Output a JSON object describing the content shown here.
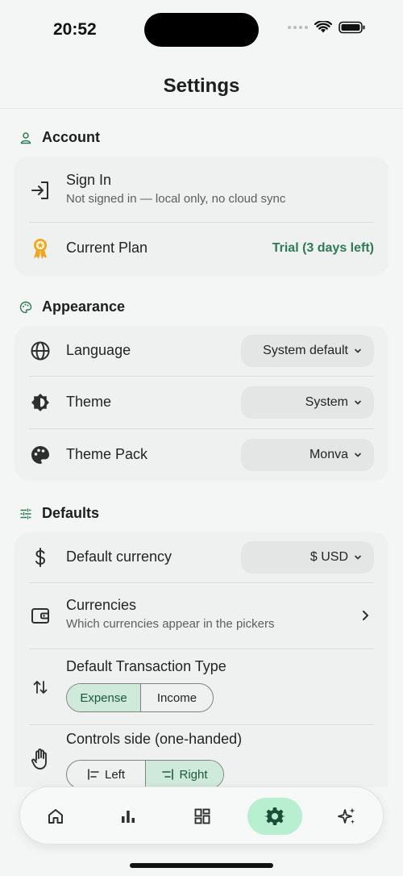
{
  "status": {
    "time": "20:52"
  },
  "header": {
    "title": "Settings"
  },
  "account": {
    "title": "Account",
    "sign_in": {
      "title": "Sign In",
      "subtitle": "Not signed in — local only, no cloud sync"
    },
    "plan": {
      "title": "Current Plan",
      "value": "Trial (3 days left)"
    }
  },
  "appearance": {
    "title": "Appearance",
    "language": {
      "title": "Language",
      "value": "System default"
    },
    "theme": {
      "title": "Theme",
      "value": "System"
    },
    "theme_pack": {
      "title": "Theme Pack",
      "value": "Monva"
    }
  },
  "defaults": {
    "title": "Defaults",
    "currency": {
      "title": "Default currency",
      "value": "$ USD"
    },
    "currencies": {
      "title": "Currencies",
      "subtitle": "Which currencies appear in the pickers"
    },
    "transaction_type": {
      "title": "Default Transaction Type",
      "options": [
        "Expense",
        "Income"
      ],
      "selected": "Expense"
    },
    "controls_side": {
      "title": "Controls side (one-handed)",
      "options": [
        "Left",
        "Right"
      ],
      "selected": "Right"
    }
  },
  "tabbar": {
    "items": [
      "home-icon",
      "chart-icon",
      "dashboard-icon",
      "settings-icon",
      "sparkles-icon"
    ],
    "active": "settings-icon"
  },
  "colors": {
    "accent": "#2e7a57",
    "active_tab": "#b7efd0",
    "segment_active": "#cfe9da"
  }
}
